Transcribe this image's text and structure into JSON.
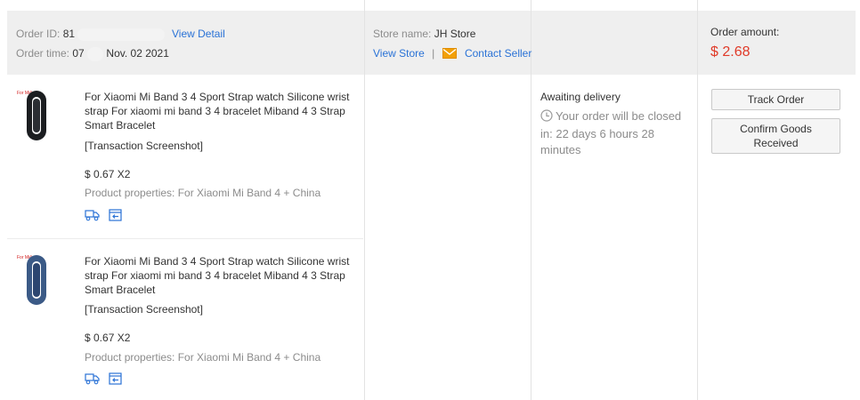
{
  "header": {
    "order_id_label": "Order ID:",
    "order_id_value": "81",
    "view_detail": "View Detail",
    "order_time_label": "Order time:",
    "order_time_prefix": "07",
    "order_time_date": "Nov. 02 2021",
    "store_label": "Store name:",
    "store_name": "JH Store",
    "view_store": "View Store",
    "separator": "|",
    "contact_seller": "Contact Seller",
    "amount_label": "Order amount:",
    "amount_value": "$ 2.68"
  },
  "products": [
    {
      "title": "For Xiaomi Mi Band 3 4 Sport Strap watch Silicone wrist strap For xiaomi mi band 3 4 bracelet Miband 4 3 Strap Smart Bracelet",
      "screenshot": "[Transaction Screenshot]",
      "price": "$ 0.67 X2",
      "properties": "Product properties: For Xiaomi Mi Band 4 + China",
      "image_color": "#1b1d20"
    },
    {
      "title": "For Xiaomi Mi Band 3 4 Sport Strap watch Silicone wrist strap For xiaomi mi band 3 4 bracelet Miband 4 3 Strap Smart Bracelet",
      "screenshot": "[Transaction Screenshot]",
      "price": "$ 0.67 X2",
      "properties": "Product properties: For Xiaomi Mi Band 4 + China",
      "image_color": "#3b5a86"
    }
  ],
  "status": {
    "title": "Awaiting delivery",
    "note": "Your order will be closed in: 22 days 6 hours 28 minutes"
  },
  "actions": {
    "track_order": "Track Order",
    "confirm_goods": "Confirm Goods Received"
  },
  "icons": {
    "mail": "envelope-icon",
    "clock": "clock-icon",
    "shipping": "shipping-truck-icon",
    "back": "back-arrow-box-icon"
  },
  "colors": {
    "link": "#2a72d6",
    "amount": "#e03a28",
    "header_bg": "#efefef",
    "mail": "#f2a007"
  }
}
